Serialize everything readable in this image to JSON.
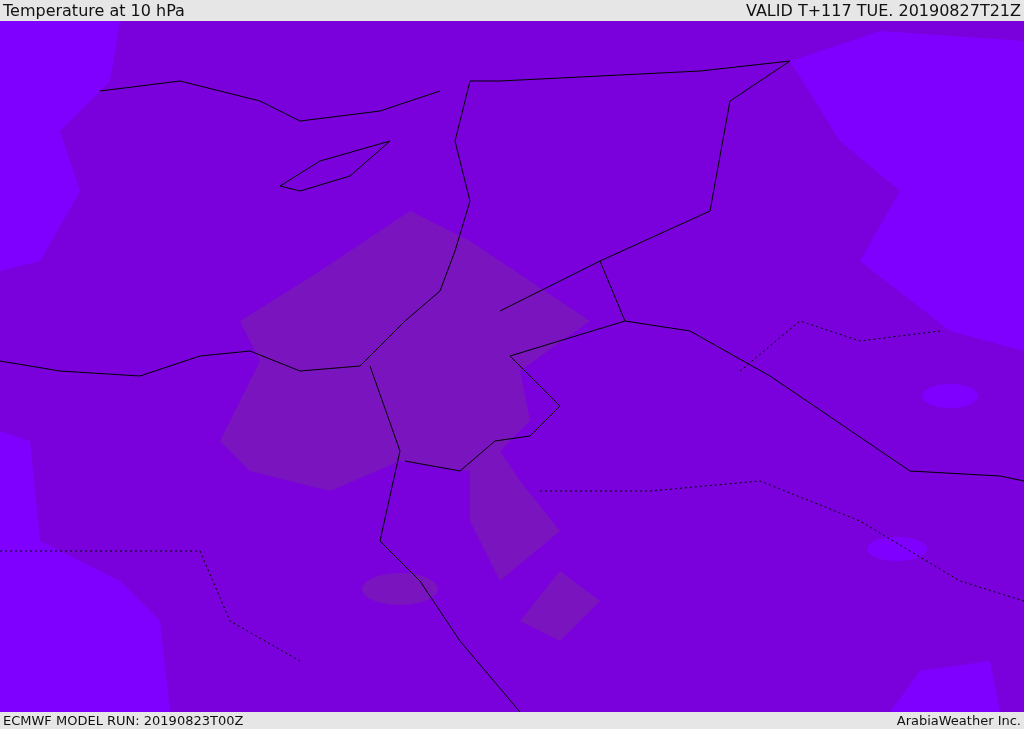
{
  "header": {
    "title": "Temperature at 10 hPa",
    "valid_time": "VALID T+117 TUE. 20190827T21Z"
  },
  "footer": {
    "model_run": "ECMWF MODEL RUN: 20190823T00Z",
    "credit": "ArabiaWeather Inc."
  }
}
